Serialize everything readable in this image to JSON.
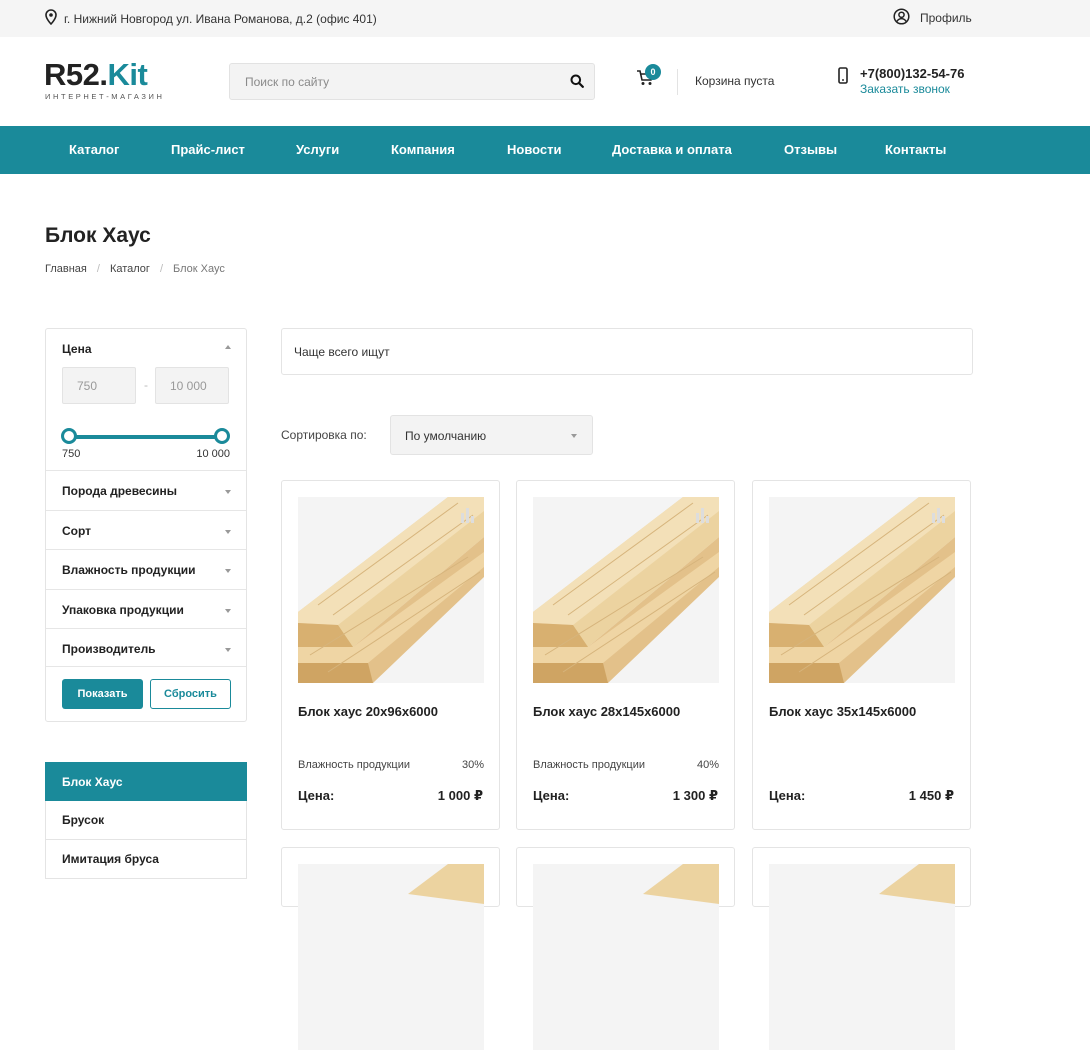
{
  "topbar": {
    "address": "г. Нижний Новгород ул. Ивана Романова, д.2 (офис 401)",
    "profile": "Профиль"
  },
  "header": {
    "logo_main": "R52.",
    "logo_accent": "Kit",
    "logo_tagline": "ИНТЕРНЕТ-МАГАЗИН",
    "search_placeholder": "Поиск по сайту",
    "cart_count": "0",
    "cart_label": "Корзина пуста",
    "phone": "+7(800)132-54-76",
    "callback": "Заказать звонок"
  },
  "nav": [
    "Каталог",
    "Прайс-лист",
    "Услуги",
    "Компания",
    "Новости",
    "Доставка и оплата",
    "Отзывы",
    "Контакты"
  ],
  "page": {
    "title": "Блок Хаус",
    "breadcrumbs": [
      "Главная",
      "Каталог",
      "Блок Хаус"
    ]
  },
  "filter": {
    "price_title": "Цена",
    "price_min": "750",
    "price_max": "10 000",
    "range_min_label": "750",
    "range_max_label": "10 000",
    "groups": [
      "Порода древесины",
      "Сорт",
      "Влажность продукции",
      "Упаковка продукции",
      "Производитель"
    ],
    "show_button": "Показать",
    "reset_button": "Сбросить"
  },
  "categories": [
    "Блок Хаус",
    "Брусок",
    "Имитация бруса"
  ],
  "content": {
    "often_searched": "Чаще всего ищут",
    "sort_label": "Сортировка по:",
    "sort_value": "По умолчанию"
  },
  "products": [
    {
      "name": "Блок хаус 20х96х6000",
      "prop_label": "Влажность продукции",
      "prop_value": "30%",
      "price_label": "Цена:",
      "price": "1 000 ₽"
    },
    {
      "name": "Блок хаус 28х145х6000",
      "prop_label": "Влажность продукции",
      "prop_value": "40%",
      "price_label": "Цена:",
      "price": "1 300 ₽"
    },
    {
      "name": "Блок хаус 35х145х6000",
      "prop_label": "",
      "prop_value": "",
      "price_label": "Цена:",
      "price": "1 450 ₽"
    }
  ],
  "colors": {
    "accent": "#1a8a9a",
    "wood_light": "#f0d9a8",
    "wood_dark": "#d9b57a"
  },
  "icons": [
    "location-icon",
    "profile-icon",
    "search-icon",
    "cart-icon",
    "phone-icon",
    "compare-icon"
  ]
}
